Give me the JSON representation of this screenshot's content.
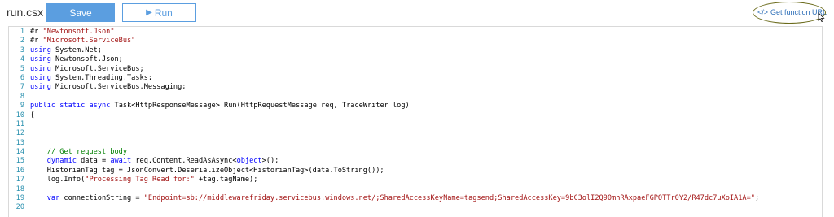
{
  "toolbar": {
    "file_name": "run.csx",
    "save_label": "Save",
    "run_label": "Run",
    "run_icon": "play-icon",
    "url_icon_text": "</>",
    "url_label": "Get function URL"
  },
  "colors": {
    "accent": "#5b9ee0",
    "link": "#2e6fb8",
    "line_number": "#2b91af",
    "keyword": "#0000ff",
    "string": "#a31515",
    "comment": "#008000"
  },
  "code_lines": [
    [
      {
        "t": "#r ",
        "c": "code"
      },
      {
        "t": "\"Newtonsoft.Json\"",
        "c": "str"
      }
    ],
    [
      {
        "t": "#r ",
        "c": "code"
      },
      {
        "t": "\"Microsoft.ServiceBus\"",
        "c": "str"
      }
    ],
    [
      {
        "t": "using",
        "c": "kw"
      },
      {
        "t": " System.Net;",
        "c": "code"
      }
    ],
    [
      {
        "t": "using",
        "c": "kw"
      },
      {
        "t": " Newtonsoft.Json;",
        "c": "code"
      }
    ],
    [
      {
        "t": "using",
        "c": "kw"
      },
      {
        "t": " Microsoft.ServiceBus;",
        "c": "code"
      }
    ],
    [
      {
        "t": "using",
        "c": "kw"
      },
      {
        "t": " System.Threading.Tasks;",
        "c": "code"
      }
    ],
    [
      {
        "t": "using",
        "c": "kw"
      },
      {
        "t": " Microsoft.ServiceBus.Messaging;",
        "c": "code"
      }
    ],
    [],
    [
      {
        "t": "public",
        "c": "kw"
      },
      {
        "t": " ",
        "c": "code"
      },
      {
        "t": "static",
        "c": "kw"
      },
      {
        "t": " ",
        "c": "code"
      },
      {
        "t": "async",
        "c": "kw"
      },
      {
        "t": " Task<HttpResponseMessage> Run(HttpRequestMessage req, TraceWriter log)",
        "c": "code"
      }
    ],
    [
      {
        "t": "{",
        "c": "code"
      }
    ],
    [],
    [],
    [],
    [
      {
        "t": "    // Get request body",
        "c": "cm"
      }
    ],
    [
      {
        "t": "    ",
        "c": "code"
      },
      {
        "t": "dynamic",
        "c": "kw"
      },
      {
        "t": " data = ",
        "c": "code"
      },
      {
        "t": "await",
        "c": "kw"
      },
      {
        "t": " req.Content.ReadAsAsync<",
        "c": "code"
      },
      {
        "t": "object",
        "c": "kw"
      },
      {
        "t": ">();",
        "c": "code"
      }
    ],
    [
      {
        "t": "    HistorianTag tag = JsonConvert.DeserializeObject<HistorianTag>(data.ToString());",
        "c": "code"
      }
    ],
    [
      {
        "t": "    log.Info(",
        "c": "code"
      },
      {
        "t": "\"Processing Tag Read for:\"",
        "c": "str"
      },
      {
        "t": " +tag.tagName);",
        "c": "code"
      }
    ],
    [],
    [
      {
        "t": "    ",
        "c": "code"
      },
      {
        "t": "var",
        "c": "kw"
      },
      {
        "t": " connectionString = ",
        "c": "code"
      },
      {
        "t": "\"Endpoint=sb://middlewarefriday.servicebus.windows.net/;SharedAccessKeyName=tagsend;SharedAccessKey=9bC3olI2Q90mhRAxpaeFGPOTTr0Y2/R47dc7uXoIA1A=\"",
        "c": "str"
      },
      {
        "t": ";",
        "c": "code"
      }
    ],
    []
  ]
}
